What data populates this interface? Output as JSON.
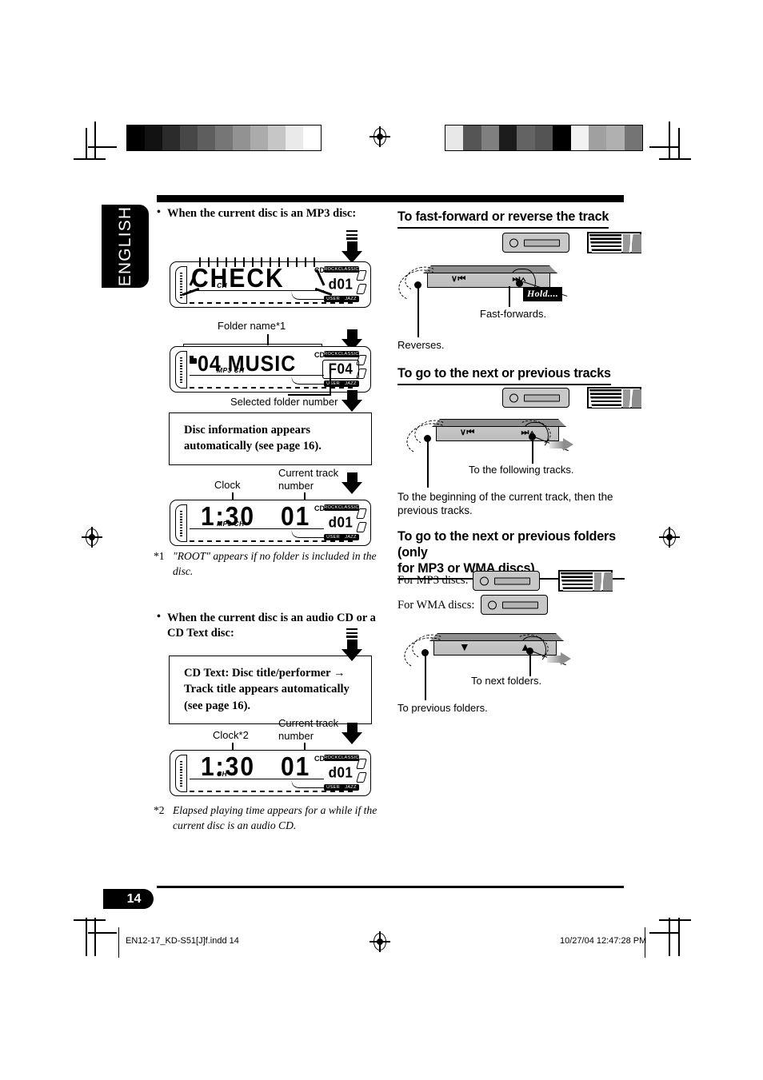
{
  "page": {
    "language_tab": "ENGLISH",
    "page_number": "14",
    "footer_file": "EN12-17_KD-S51[J]f.indd   14",
    "footer_datetime": "10/27/04   12:47:28 PM"
  },
  "calibration": {
    "left_swatches": [
      "#000000",
      "#121212",
      "#2b2b2b",
      "#474747",
      "#5e5e5e",
      "#767676",
      "#929292",
      "#ababab",
      "#c6c6c6",
      "#eaeaea",
      "#ffffff"
    ],
    "right_swatches": [
      "#e8e8e8",
      "#555555",
      "#7f7f7f",
      "#1c1c1c",
      "#636363",
      "#545454",
      "#000000",
      "#f2f2f2",
      "#a0a0a0",
      "#b0b0b0",
      "#747474"
    ]
  },
  "left_column": {
    "mp3_heading": "When the current disc is an MP3 disc:",
    "display_check": {
      "main_text": "CHECK",
      "sub_code": "d01",
      "sub_top_left": "ROCK",
      "sub_top_right": "CLASSIC",
      "sub_bottom_left": "USER",
      "sub_bottom_right": "JAZZ",
      "tag": "CH"
    },
    "folder_label": "Folder name*1",
    "display_folder": {
      "main_text": "04  MUSIC",
      "sub_code": "F04",
      "sub_top_left": "ROCK",
      "sub_top_right": "CLASSIC",
      "sub_bottom_left": "USER",
      "sub_bottom_right": "JAZZ",
      "tag": "MP3 CH"
    },
    "folder_number_label": "Selected folder number",
    "info_box_1": "Disc information appears automatically (see page 16).",
    "clock_label": "Clock",
    "track_label": "Current track number",
    "display_clock_mp3": {
      "time": "1:30",
      "track": "01",
      "sub_code": "d01",
      "sub_top_left": "ROCK",
      "sub_top_right": "CLASSIC",
      "sub_bottom_left": "USER",
      "sub_bottom_right": "JAZZ",
      "tag": "MP3 CH"
    },
    "footnote_1_marker": "*1",
    "footnote_1": "\"ROOT\" appears if no folder is included in the disc.",
    "cd_heading": "When the current disc is an audio CD or a CD Text disc:",
    "info_box_2": "CD Text: Disc title/performer → Track title appears automatically (see page 16).",
    "clock_label_2": "Clock*2",
    "track_label_2": "Current track number",
    "display_clock_cd": {
      "time": "1:30",
      "track": "01",
      "sub_code": "d01",
      "sub_top_left": "ROCK",
      "sub_top_right": "CLASSIC",
      "sub_bottom_left": "USER",
      "sub_bottom_right": "JAZZ",
      "tag": "CH"
    },
    "footnote_2_marker": "*2",
    "footnote_2": "Elapsed playing time appears for a while if the current disc is an audio CD."
  },
  "right_column": {
    "section1": {
      "heading": "To fast-forward or reverse the track",
      "btn_left_label": "∨⏮",
      "btn_right_label": "⏭∧",
      "hold_badge": "Hold....",
      "caption_forward": "Fast-forwards.",
      "caption_reverse": "Reverses."
    },
    "section2": {
      "heading": "To go to the next or previous tracks",
      "btn_left_label": "∨⏮",
      "btn_right_label": "⏭∧",
      "caption_next": "To the following tracks.",
      "caption_prev": "To the beginning of the current track, then the previous tracks."
    },
    "section3": {
      "heading_line1": "To go to the next or previous folders (only",
      "heading_line2": "for MP3 or WMA discs)",
      "mp3_label": "For MP3 discs:",
      "wma_label": "For WMA discs:",
      "btn_left_label": "▼",
      "btn_right_label": "▲",
      "caption_next": "To next folders.",
      "caption_prev": "To previous folders."
    }
  },
  "icons": {
    "remote": "remote-control-icon",
    "unit": "car-stereo-unit-icon"
  }
}
